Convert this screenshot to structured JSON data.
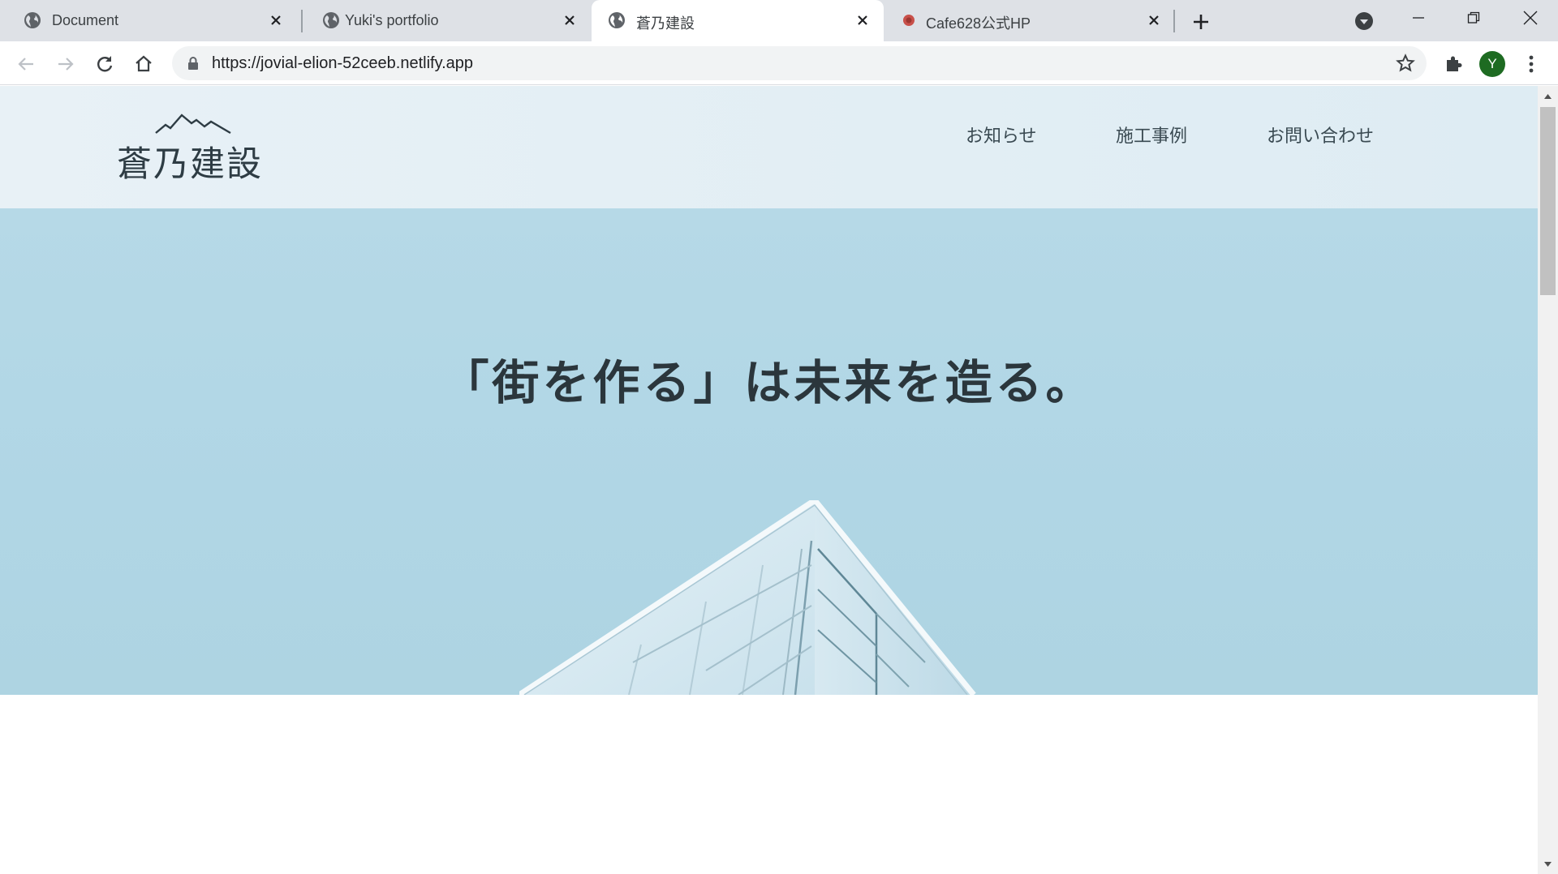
{
  "browser": {
    "tabs": [
      {
        "title": "Document",
        "icon": "globe-icon",
        "active": false
      },
      {
        "title": "Yuki's portfolio",
        "icon": "globe-icon",
        "active": false
      },
      {
        "title": "蒼乃建設",
        "icon": "globe-icon",
        "active": true
      },
      {
        "title": "Cafe628公式HP",
        "icon": "cafe-favicon-icon",
        "active": false
      }
    ],
    "url": "https://jovial-elion-52ceeb.netlify.app",
    "profile_initial": "Y",
    "profile_color": "#1e6b22"
  },
  "site": {
    "logo_text": "蒼乃建設",
    "nav": [
      "お知らせ",
      "施工事例",
      "お問い合わせ"
    ],
    "hero_copy": "「街を作る」は未来を造る。",
    "colors": {
      "header_bg": "#e3eff5",
      "hero_sky": "#b3d8e6",
      "text": "#2e3c44"
    }
  }
}
